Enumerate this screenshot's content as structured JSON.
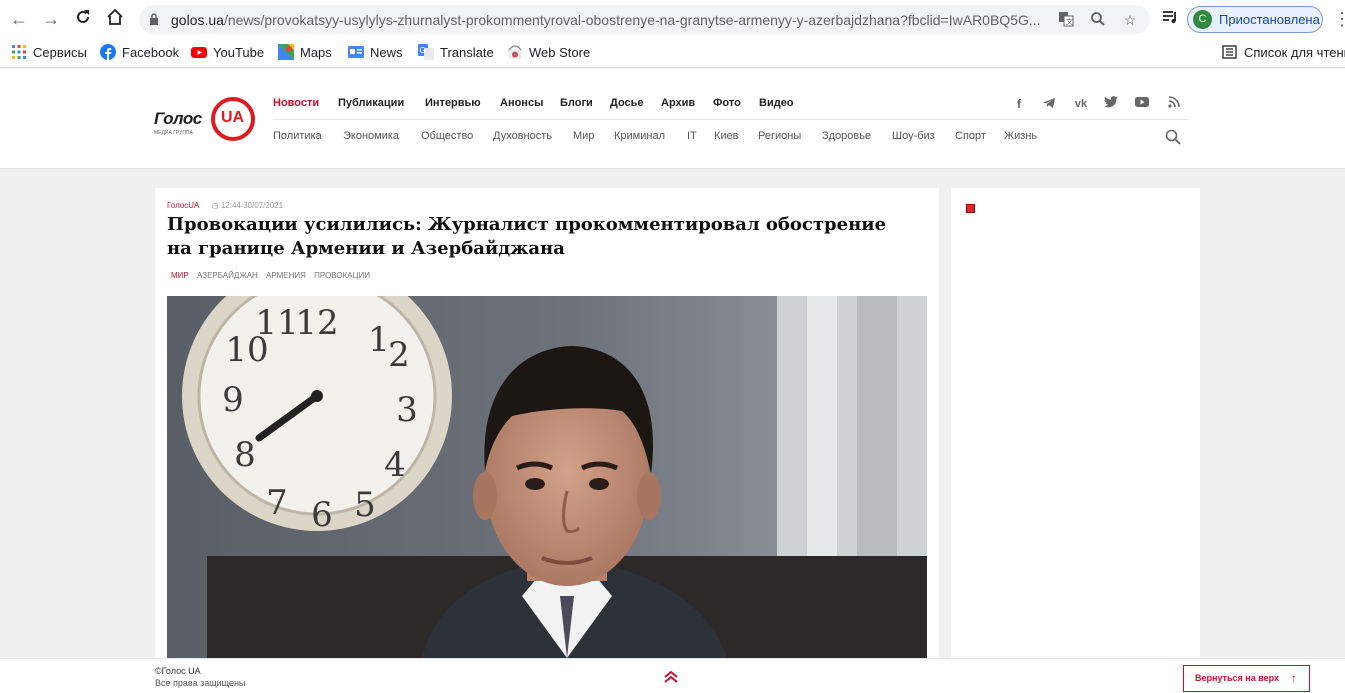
{
  "browser": {
    "url_host": "golos.ua",
    "url_path": "/news/provokatsyy-usylylys-zhurnalyst-prokommentyroval-obostrenye-na-granytse-armenyy-y-azerbajdzhana?fbclid=IwAR0BQ5G...",
    "profile_initial": "С",
    "profile_label": "Приостановлена",
    "reading_list": "Список для чтения",
    "bookmarks": [
      {
        "label": "Сервисы",
        "icon": "apps-grid-icon"
      },
      {
        "label": "Facebook",
        "icon": "facebook-icon"
      },
      {
        "label": "YouTube",
        "icon": "youtube-icon"
      },
      {
        "label": "Maps",
        "icon": "maps-icon"
      },
      {
        "label": "News",
        "icon": "google-news-icon"
      },
      {
        "label": "Translate",
        "icon": "translate-icon"
      },
      {
        "label": "Web Store",
        "icon": "web-store-icon"
      }
    ]
  },
  "site": {
    "logo_text": "Голос",
    "logo_ua": "UA",
    "logo_sub": "МЕДИА ГРУППА",
    "topnav": [
      "Новости",
      "Публикации",
      "Интервью",
      "Анонсы",
      "Блоги",
      "Досье",
      "Архив",
      "Фото",
      "Видео"
    ],
    "subnav": [
      "Политика",
      "Экономика",
      "Общество",
      "Духовность",
      "Мир",
      "Криминал",
      "IT",
      "Киев",
      "Регионы",
      "Здоровье",
      "Шоу-биз",
      "Спорт",
      "Жизнь"
    ],
    "social": [
      "facebook-icon",
      "telegram-icon",
      "vk-icon",
      "twitter-icon",
      "youtube-icon",
      "rss-icon"
    ]
  },
  "article": {
    "source": "ГолосUA",
    "datetime": "12:44 30/07/2021",
    "headline": "Провокации усилились: Журналист прокомментировал обострение на границе Армении и Азербайджана",
    "tags": [
      "МИР",
      "АЗЕРБАЙДЖАН",
      "АРМЕНИЯ",
      "ПРОВОКАЦИИ"
    ]
  },
  "footer": {
    "copyright": "©Голос UA",
    "rights": "Все права защищены",
    "back_to_top": "Вернуться на верх"
  },
  "colors": {
    "accent": "#c8102e",
    "page_bg": "#f0f0f0"
  }
}
